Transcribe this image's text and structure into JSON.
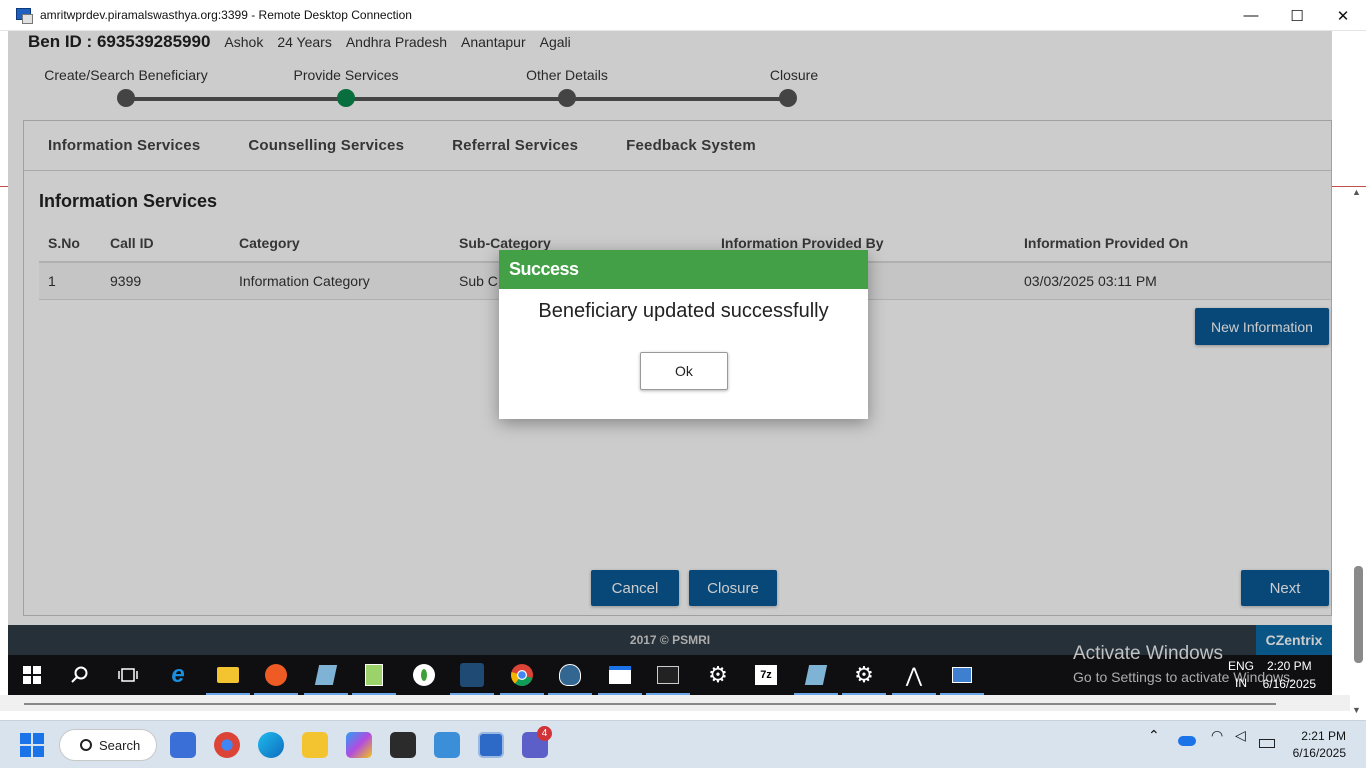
{
  "window": {
    "title": "amritwprdev.piramalswasthya.org:3399 - Remote Desktop Connection",
    "minimize_glyph": "—",
    "maximize_glyph": "☐",
    "close_glyph": "✕"
  },
  "beneficiary": {
    "id": "Ben ID : 693539285990",
    "name": "Ashok",
    "age": "24 Years",
    "state": "Andhra Pradesh",
    "district": "Anantapur",
    "block": "Agali"
  },
  "stepper": {
    "steps": [
      {
        "label": "Create/Search Beneficiary",
        "active": false
      },
      {
        "label": "Provide Services",
        "active": true
      },
      {
        "label": "Other Details",
        "active": false
      },
      {
        "label": "Closure",
        "active": false
      }
    ]
  },
  "tabs": [
    "Information Services",
    "Counselling Services",
    "Referral Services",
    "Feedback System"
  ],
  "section": {
    "title": "Information Services",
    "columns": [
      "S.No",
      "Call ID",
      "Category",
      "Sub-Category",
      "Information Provided By",
      "Information Provided On"
    ],
    "rows": [
      [
        "1",
        "9399",
        "Information Category",
        "Sub C",
        "",
        "03/03/2025 03:11 PM"
      ]
    ],
    "new_button": "New Information"
  },
  "actions": {
    "cancel": "Cancel",
    "closure": "Closure",
    "next": "Next"
  },
  "footer": {
    "copyright": "2017 © PSMRI",
    "brand": "CZentrix"
  },
  "dialog": {
    "title": "Success",
    "message": "Beneficiary updated successfully",
    "ok": "Ok"
  },
  "remote_taskbar": {
    "watermark_title": "Activate Windows",
    "watermark_sub": "Go to Settings to activate Windows.",
    "lang_top": "ENG",
    "lang_bottom": "IN",
    "time": "2:20 PM",
    "date": "6/16/2025"
  },
  "host_taskbar": {
    "search": "Search",
    "time": "2:21 PM",
    "date": "6/16/2025",
    "teams_badge": "4"
  },
  "colors": {
    "primary": "#0b5a96",
    "success": "#43a047",
    "step_active": "#0c8a4e",
    "footer": "#2f3c47"
  }
}
